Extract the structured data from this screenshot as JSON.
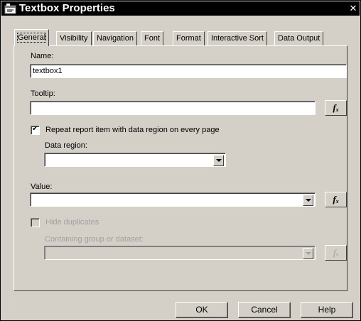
{
  "dialog": {
    "title": "Textbox Properties",
    "close_glyph": "✕"
  },
  "tabs": [
    {
      "label": "General",
      "active": true
    },
    {
      "label": "Visibility"
    },
    {
      "label": "Navigation"
    },
    {
      "label": "Font"
    },
    {
      "label": "Format"
    },
    {
      "label": "Interactive Sort"
    },
    {
      "label": "Data Output"
    }
  ],
  "general": {
    "name_label": "Name:",
    "name_value": "textbox1",
    "tooltip_label": "Tooltip:",
    "tooltip_value": "",
    "repeat_label": "Repeat report item with data region on every page",
    "repeat_checked": true,
    "data_region_label": "Data region:",
    "data_region_value": "",
    "value_label": "Value:",
    "value_value": "",
    "hide_duplicates_label": "Hide duplicates",
    "hide_duplicates_checked": false,
    "containing_group_label": "Containing group or dataset:",
    "containing_group_value": "",
    "fx_label": "f",
    "fx_sub": "x"
  },
  "buttons": {
    "ok": "OK",
    "cancel": "Cancel",
    "help": "Help"
  },
  "icons": {
    "title": "dialog-properties-icon",
    "close": "close-icon",
    "dropdown": "chevron-down-icon",
    "expression": "function-fx-icon"
  },
  "colors": {
    "face": "#d4d0c8",
    "titlebar": "#000000",
    "disabled_text": "#a0a0a0"
  }
}
